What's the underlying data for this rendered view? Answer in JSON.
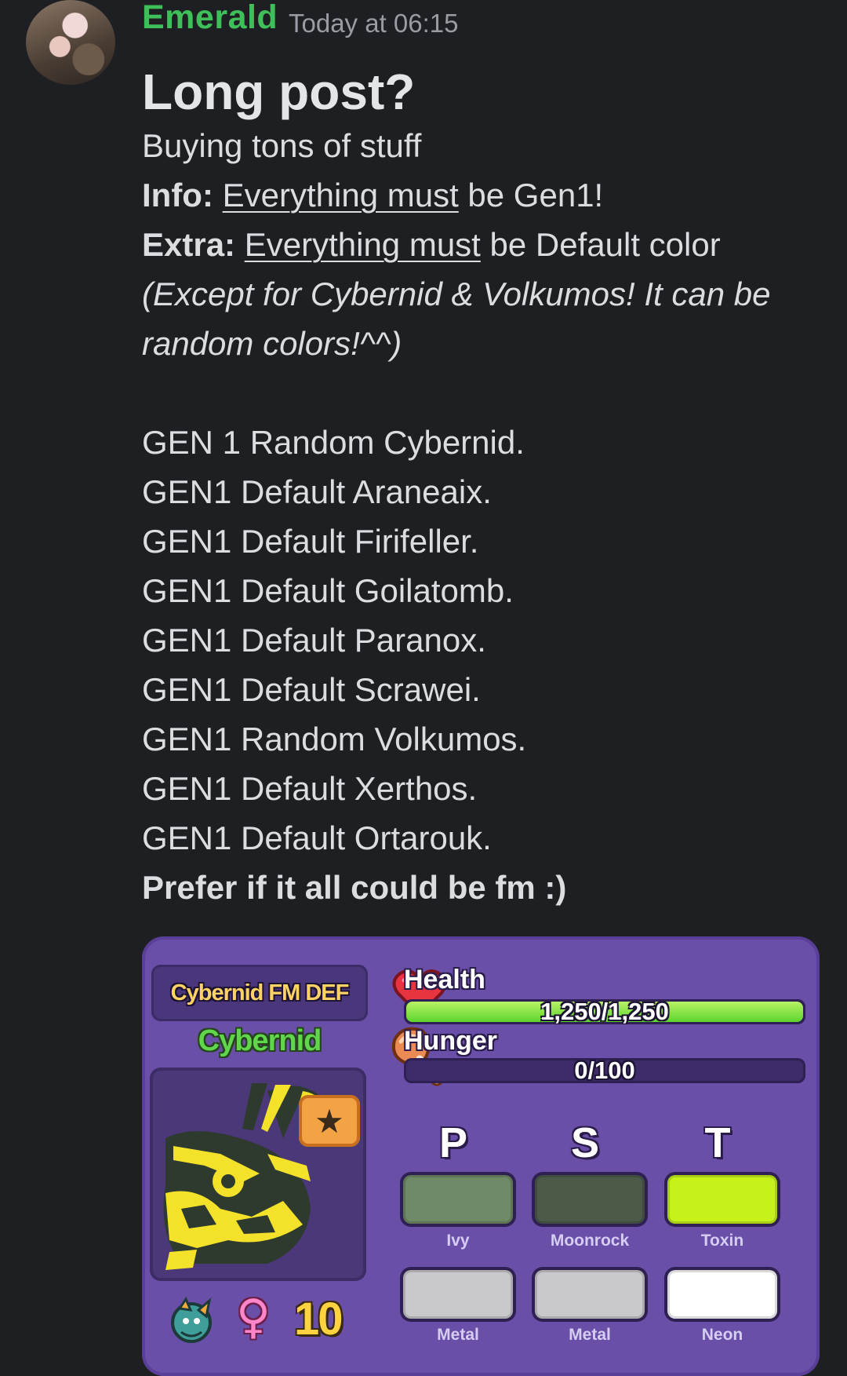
{
  "message": {
    "author": "Emerald",
    "timestamp": "Today at 06:15",
    "title": "Long post?",
    "line1": "Buying tons of stuff",
    "info_label": "Info:",
    "info_underlined": "Everything must",
    "info_rest": " be Gen1!",
    "extra_label": "Extra:",
    "extra_underlined": "Everything must",
    "extra_rest": " be Default color",
    "italic_line1": "(Except for Cybernid & Volkumos! It can be",
    "italic_line2": "random colors!^^)",
    "items": [
      "GEN 1 Random Cybernid.",
      "GEN1 Default Araneaix.",
      "GEN1 Default Firifeller.",
      "GEN1 Default Goilatomb.",
      "GEN1 Default Paranox.",
      "GEN1 Default Scrawei.",
      "GEN1 Random Volkumos.",
      "GEN1 Default Xerthos.",
      "GEN1 Default Ortarouk."
    ],
    "closing": "Prefer if it all could be fm :)"
  },
  "card": {
    "title": "Cybernid FM DEF",
    "species": "Cybernid",
    "level": "10",
    "health_label": "Health",
    "health_text": "1,250/1,250",
    "health_fraction": 1.0,
    "hunger_label": "Hunger",
    "hunger_text": "0/100",
    "hunger_fraction": 0.0,
    "pst": [
      "P",
      "S",
      "T"
    ],
    "swatches_top": [
      {
        "label": "Ivy",
        "color": "#6f8a66"
      },
      {
        "label": "Moonrock",
        "color": "#4c5a48"
      },
      {
        "label": "Toxin",
        "color": "#c6f21a"
      }
    ],
    "swatches_bottom": [
      {
        "label": "Metal",
        "color": "#c9c9cd"
      },
      {
        "label": "Metal",
        "color": "#c9c9cd"
      },
      {
        "label": "Neon",
        "color": "#ffffff"
      }
    ]
  },
  "colors": {
    "author": "#3fbf5a",
    "background": "#1e1f23",
    "card_bg": "#6a4fa8"
  }
}
